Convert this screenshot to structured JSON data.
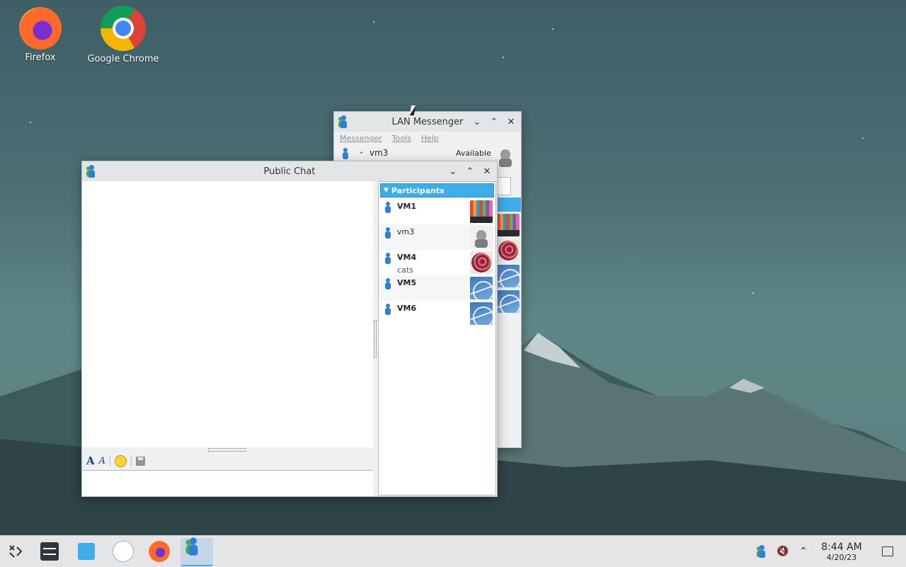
{
  "desktop": {
    "icons": [
      {
        "label": "Firefox"
      },
      {
        "label": "Google Chrome"
      }
    ]
  },
  "lan_messenger": {
    "title": "LAN Messenger",
    "menu": [
      "Messenger",
      "Tools",
      "Help"
    ],
    "user": {
      "name": "vm3",
      "status": "Available"
    }
  },
  "public_chat": {
    "title": "Public Chat",
    "participants_header": "Participants",
    "participants": [
      {
        "name": "VM1",
        "status": "",
        "avatar": "crayons"
      },
      {
        "name": "vm3",
        "status": "",
        "avatar": "robot"
      },
      {
        "name": "VM4",
        "status": "cats",
        "avatar": "ball"
      },
      {
        "name": "VM5",
        "status": "",
        "avatar": "bridge"
      },
      {
        "name": "VM6",
        "status": "",
        "avatar": "bridge"
      }
    ],
    "toolbar_icons": [
      "font-icon",
      "font-color-icon",
      "smiley-icon",
      "save-icon"
    ]
  },
  "taskbar": {
    "clock_time": "8:44 AM",
    "clock_date": "4/20/23",
    "accent": "#3daee9"
  }
}
